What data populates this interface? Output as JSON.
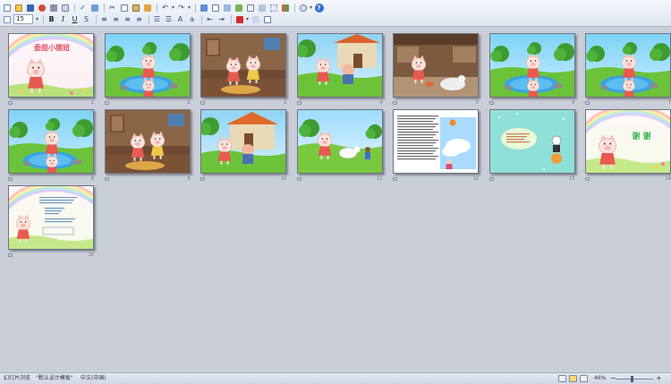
{
  "toolbar": {
    "font_size": "15",
    "help_glyph": "?"
  },
  "slides": [
    {
      "num": "1",
      "scene": "title",
      "title_text": "委屈小猪妞"
    },
    {
      "num": "2",
      "scene": "pond"
    },
    {
      "num": "3",
      "scene": "room"
    },
    {
      "num": "4",
      "scene": "yard"
    },
    {
      "num": "5",
      "scene": "kitchen"
    },
    {
      "num": "6",
      "scene": "pond"
    },
    {
      "num": "7",
      "scene": "pond"
    },
    {
      "num": "8",
      "scene": "pond"
    },
    {
      "num": "9",
      "scene": "room"
    },
    {
      "num": "10",
      "scene": "house"
    },
    {
      "num": "11",
      "scene": "meadow"
    },
    {
      "num": "12",
      "scene": "sky"
    },
    {
      "num": "13",
      "scene": "teal"
    },
    {
      "num": "14",
      "scene": "thanks",
      "title_text": "谢 谢"
    },
    {
      "num": "15",
      "scene": "ending"
    }
  ],
  "statusbar": {
    "view_label": "幻灯片浏览",
    "theme_label": "\"默认设计模板\"",
    "language_label": "中文(中国)",
    "zoom_label": "46%"
  },
  "icons": {
    "toolbar": [
      "new-file-icon",
      "open-folder-icon",
      "save-icon",
      "print-icon",
      "preview-icon",
      "spelling-icon",
      "cut-icon",
      "copy-icon",
      "paste-icon",
      "format-painter-icon",
      "undo-icon",
      "redo-icon",
      "insert-chart-icon",
      "insert-table-icon",
      "zoom-icon",
      "help-icon"
    ]
  }
}
